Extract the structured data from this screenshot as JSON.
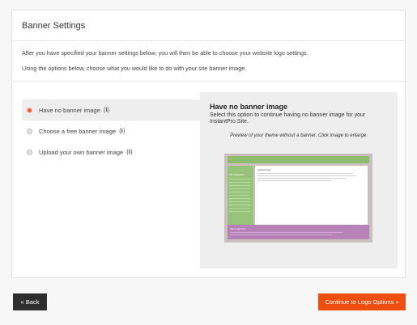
{
  "header": {
    "title": "Banner Settings"
  },
  "intro": {
    "line1": "After you have specified your banner settings below; you will then be able to choose your website logo settings.",
    "line2": "Using the options below, choose what you would like to do with your site banner image."
  },
  "options": [
    {
      "label": "Have no banner image",
      "info_icon": "ℹ",
      "selected": true
    },
    {
      "label": "Choose a free banner image",
      "info_icon": "ℹ",
      "selected": false
    },
    {
      "label": "Upload your own banner image",
      "info_icon": "ℹ",
      "selected": false
    }
  ],
  "preview": {
    "title": "Have no banner image",
    "description": "Select this option to continue having no banner image for your InstantPro Site.",
    "caption": "Preview of your theme without a banner. Click image to enlarge.",
    "thumb": {
      "nav_label": "Site Navigation",
      "content_title": "Content Area",
      "footer_label": "Site Footer Text"
    }
  },
  "buttons": {
    "back": "« Back",
    "continue": "Continue to Logo Options »"
  },
  "colors": {
    "accent": "#f04e0e",
    "back_button": "#2e2e2e",
    "thumb_green": "#97c47a",
    "thumb_purple": "#b682b8"
  }
}
